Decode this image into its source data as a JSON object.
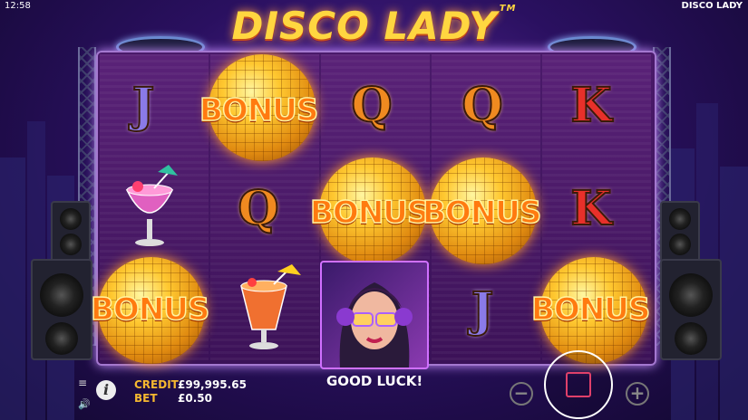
{
  "status": {
    "clock": "12:58",
    "game_name": "DISCO LADY"
  },
  "logo": {
    "text": "DISCO LADY",
    "tm": "TM"
  },
  "grid": {
    "reels": [
      [
        "J",
        "Cocktail (pink)",
        "Bonus"
      ],
      [
        "Bonus",
        "Q",
        "Cocktail (orange)"
      ],
      [
        "Q",
        "Bonus",
        "Disco Lady"
      ],
      [
        "Q",
        "Bonus",
        "J"
      ],
      [
        "K",
        "K",
        "Bonus"
      ]
    ],
    "bonus_label": "BONUS"
  },
  "footer": {
    "credit_label": "CREDIT",
    "credit_value": "£99,995.65",
    "bet_label": "BET",
    "bet_value": "£0.50",
    "message": "GOOD LUCK!"
  },
  "controls": {
    "menu_icon": "hamburger-icon",
    "info_icon": "info-icon",
    "sound_icon": "speaker-icon",
    "minus_icon": "minus-icon",
    "plus_icon": "plus-icon",
    "spin_icon": "stop-square-icon"
  },
  "colors": {
    "accent_gold": "#f5b830",
    "bonus_orange": "#ff7a10",
    "frame_purple": "#a478d0"
  }
}
